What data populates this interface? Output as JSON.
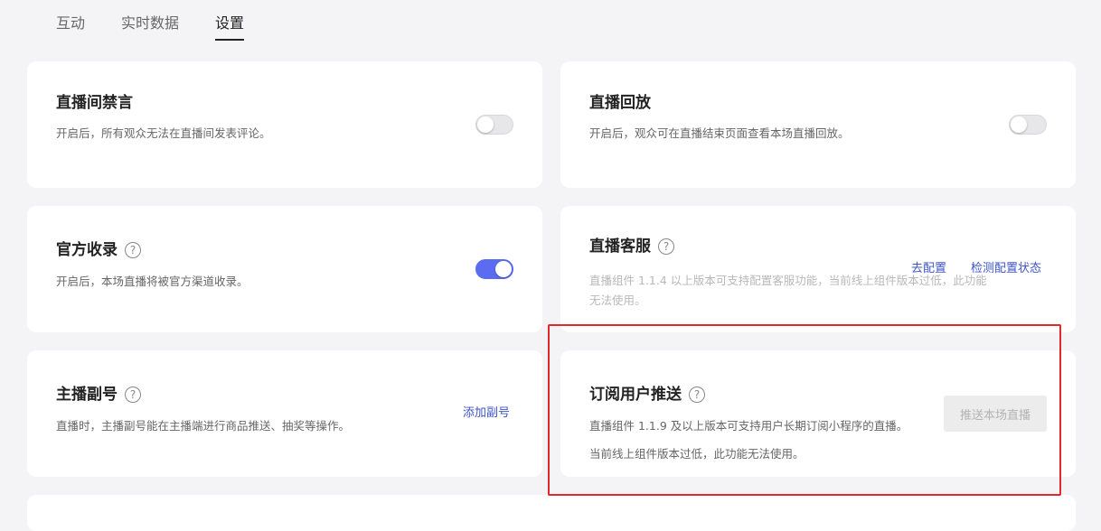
{
  "tabs": [
    {
      "label": "互动"
    },
    {
      "label": "实时数据"
    },
    {
      "label": "设置"
    }
  ],
  "cards": {
    "mute": {
      "title": "直播间禁言",
      "desc": "开启后，所有观众无法在直播间发表评论。",
      "toggle_on": false
    },
    "replay": {
      "title": "直播回放",
      "desc": "开启后，观众可在直播结束页面查看本场直播回放。",
      "toggle_on": false
    },
    "official": {
      "title": "官方收录",
      "help": "?",
      "desc": "开启后，本场直播将被官方渠道收录。",
      "toggle_on": true
    },
    "service": {
      "title": "直播客服",
      "help": "?",
      "desc": "直播组件 1.1.4 以上版本可支持配置客服功能，当前线上组件版本过低，此功能无法使用。",
      "configure_link": "去配置",
      "check_link": "检测配置状态"
    },
    "assistant": {
      "title": "主播副号",
      "help": "?",
      "desc": "直播时，主播副号能在主播端进行商品推送、抽奖等操作。",
      "add_link": "添加副号"
    },
    "subscribe": {
      "title": "订阅用户推送",
      "help": "?",
      "desc": "直播组件 1.1.9 及以上版本可支持用户长期订阅小程序的直播。",
      "desc2": "当前线上组件版本过低，此功能无法使用。",
      "push_button": "推送本场直播"
    }
  },
  "colors": {
    "accent": "#5b6cf0",
    "link": "#3d56c8",
    "highlight": "#e02a2a",
    "background": "#f4f4f6"
  }
}
